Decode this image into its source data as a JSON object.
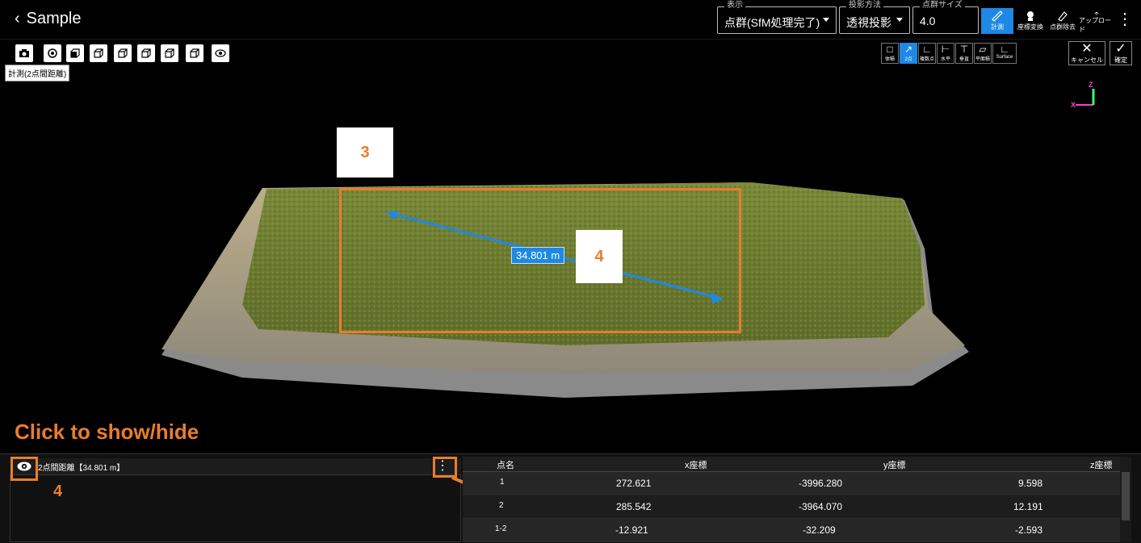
{
  "header": {
    "back_label": "Sample"
  },
  "display": {
    "legend": "表示",
    "value": "点群(SfM処理完了)"
  },
  "projection": {
    "legend": "投影方法",
    "value": "透視投影"
  },
  "pointsize": {
    "legend": "点群サイズ",
    "value": "4.0"
  },
  "top_tools": [
    {
      "label": "計測",
      "icon": "ruler-icon",
      "active": true
    },
    {
      "label": "座標変換",
      "icon": "coordinate-icon",
      "active": false
    },
    {
      "label": "点群除去",
      "icon": "eraser-icon",
      "active": false
    },
    {
      "label": "アップロード",
      "icon": "upload-icon",
      "active": false
    }
  ],
  "tooltip": "計測(2点間距離)",
  "measure_modes": [
    "体積",
    "2点",
    "複数点",
    "水平",
    "垂直",
    "平面積",
    "Surface"
  ],
  "actions": {
    "cancel": "キャンセル",
    "confirm": "確定"
  },
  "axes": {
    "z": "Z",
    "x": "X"
  },
  "viewer": {
    "distance_label": "34.801 m"
  },
  "annotations": {
    "n3": "3",
    "n4a": "4",
    "n4b": "4",
    "hint": "Click to show/hide"
  },
  "panel": {
    "item_label": "2点間距離【34.801 m】"
  },
  "table": {
    "headers": [
      "点名",
      "x座標",
      "y座標",
      "z座標"
    ],
    "rows": [
      [
        "1",
        "272.621",
        "-3996.280",
        "9.598"
      ],
      [
        "2",
        "285.542",
        "-3964.070",
        "12.191"
      ],
      [
        "1-2",
        "-12.921",
        "-32.209",
        "-2.593"
      ]
    ]
  },
  "colors": {
    "accent": "#1e88e5",
    "annotation": "#e87d2e"
  }
}
